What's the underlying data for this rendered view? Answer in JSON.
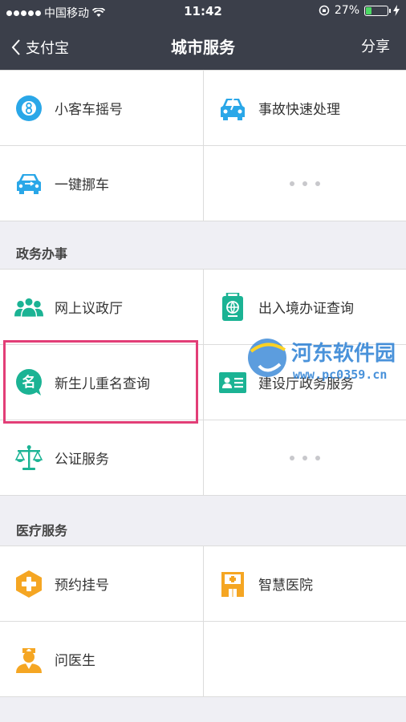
{
  "status_bar": {
    "carrier": "中国移动",
    "time": "11:42",
    "battery": "27%",
    "battery_level": 0.27
  },
  "nav": {
    "back_label": "支付宝",
    "title": "城市服务",
    "share_label": "分享"
  },
  "traffic": {
    "items": [
      {
        "label": "小客车摇号",
        "icon": "lottery-icon"
      },
      {
        "label": "事故快速处理",
        "icon": "accident-car-icon"
      },
      {
        "label": "一键挪车",
        "icon": "move-car-icon"
      }
    ]
  },
  "gov": {
    "title": "政务办事",
    "items": [
      {
        "label": "网上议政厅",
        "icon": "people-group-icon"
      },
      {
        "label": "出入境办证查询",
        "icon": "passport-icon"
      },
      {
        "label": "新生儿重名查询",
        "icon": "name-chat-icon",
        "glyph": "名"
      },
      {
        "label": "建设厅政务服务",
        "icon": "id-card-icon"
      },
      {
        "label": "公证服务",
        "icon": "scales-icon"
      }
    ]
  },
  "medical": {
    "title": "医疗服务",
    "items": [
      {
        "label": "预约挂号",
        "icon": "medical-cross-icon"
      },
      {
        "label": "智慧医院",
        "icon": "hospital-icon"
      },
      {
        "label": "问医生",
        "icon": "doctor-icon"
      }
    ]
  },
  "watermark": {
    "name": "河东软件园",
    "url": "www.pc0359.cn"
  },
  "colors": {
    "nav_bg": "#3b3f4a",
    "accent_blue": "#2aa7e8",
    "accent_green": "#1bb394",
    "accent_orange": "#f5a623",
    "highlight": "#e23e77"
  }
}
